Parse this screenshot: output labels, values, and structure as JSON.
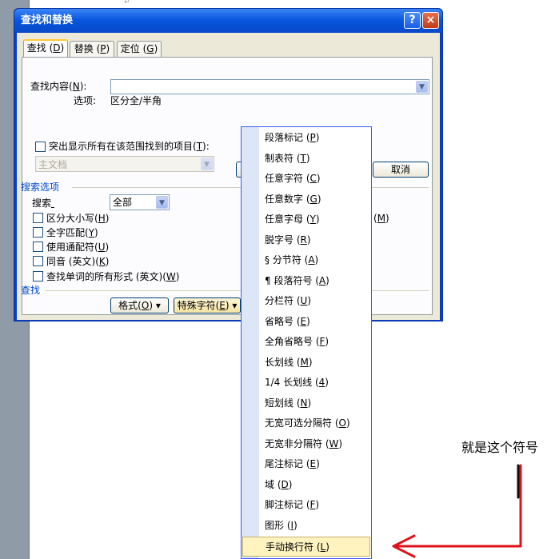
{
  "dialog": {
    "title": "查找和替换",
    "help_label": "?",
    "close_label": "×",
    "tabs": [
      {
        "pre": "查找 ",
        "key": "D",
        "post": ""
      },
      {
        "pre": "替换 ",
        "key": "P",
        "post": ""
      },
      {
        "pre": "定位 ",
        "key": "G",
        "post": ""
      }
    ],
    "find_label_pre": "查找内容",
    "find_label_key": "N",
    "find_value": "",
    "options_label": "选项:",
    "options_value": "区分全/半角",
    "highlight_label_pre": "突出显示所有在该范围找到的项目",
    "highlight_label_key": "T",
    "scope_value": "主文档",
    "cancel_label": "取消",
    "search_options_title": "搜索选项",
    "search_label": "搜索",
    "search_value": "全部",
    "checkboxes": [
      {
        "pre": "区分大小写",
        "key": "H"
      },
      {
        "pre": "全字匹配",
        "key": "Y"
      },
      {
        "pre": "使用通配符",
        "key": "U"
      },
      {
        "pre": "同音 (英文)",
        "key": "K"
      },
      {
        "pre": "查找单词的所有形式 (英文)",
        "key": "W"
      }
    ],
    "hidden_right_key": "M",
    "find_section_title": "查找",
    "format_pre": "格式",
    "format_key": "O",
    "special_pre": "特殊字符",
    "special_key": "E",
    "dropdown_arrow": "▾",
    "combo_arrow": "▼"
  },
  "menu": {
    "items": [
      {
        "pre": "段落标记",
        "key": "P"
      },
      {
        "pre": "制表符",
        "key": "T"
      },
      {
        "pre": "任意字符",
        "key": "C"
      },
      {
        "pre": "任意数字",
        "key": "G"
      },
      {
        "pre": "任意字母",
        "key": "Y"
      },
      {
        "pre": "脱字号",
        "key": "R"
      },
      {
        "pre": "§ 分节符",
        "key": "A"
      },
      {
        "pre": "¶ 段落符号",
        "key": "A"
      },
      {
        "pre": "分栏符",
        "key": "U"
      },
      {
        "pre": "省略号",
        "key": "E"
      },
      {
        "pre": "全角省略号",
        "key": "F"
      },
      {
        "pre": "长划线",
        "key": "M"
      },
      {
        "pre": "1/4 长划线",
        "key": "4"
      },
      {
        "pre": "短划线",
        "key": "N"
      },
      {
        "pre": "无宽可选分隔符",
        "key": "O"
      },
      {
        "pre": "无宽非分隔符",
        "key": "W"
      },
      {
        "pre": "尾注标记",
        "key": "E"
      },
      {
        "pre": "域",
        "key": "D"
      },
      {
        "pre": "脚注标记",
        "key": "F"
      },
      {
        "pre": "图形",
        "key": "I"
      },
      {
        "pre": "手动换行符",
        "key": "L"
      }
    ],
    "selected_index": 20
  },
  "annotation": {
    "text": "就是这个符号",
    "color": "#e0101a"
  },
  "colors": {
    "title_bar": "#0a58e0",
    "dialog_face": "#ece9d8",
    "menu_highlight": "#fff3c0",
    "section_blue": "#0046d5"
  }
}
